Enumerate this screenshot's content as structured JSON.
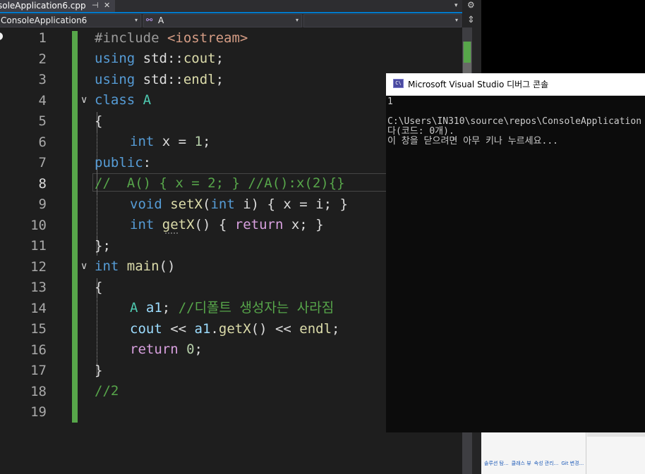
{
  "tab": {
    "title": "soleApplication6.cpp",
    "pin_glyph": "⊣",
    "close_glyph": "✕",
    "dropdown_glyph": "▾",
    "settings_glyph": "⚙"
  },
  "nav": {
    "project": "ConsoleApplication6",
    "class": "A",
    "member": "",
    "caret": "▾",
    "split_glyph": "⇕"
  },
  "editor": {
    "line_numbers": [
      "1",
      "2",
      "3",
      "4",
      "5",
      "6",
      "7",
      "8",
      "9",
      "10",
      "11",
      "12",
      "13",
      "14",
      "15",
      "16",
      "17",
      "18",
      "19"
    ],
    "current_line": 8,
    "fold_glyph": "∨"
  },
  "code": {
    "l1": [
      "#include ",
      "<iostream>"
    ],
    "l2": [
      "using",
      " std::",
      "cout",
      ";"
    ],
    "l3": [
      "using",
      " std::",
      "endl",
      ";"
    ],
    "l4": [
      "class",
      " ",
      "A"
    ],
    "l5": [
      "{"
    ],
    "l6": [
      "int",
      " x = ",
      "1",
      ";"
    ],
    "l7": [
      "public",
      ":"
    ],
    "l8": [
      "//  A() { x = 2; } //A():x(2){}"
    ],
    "l9": [
      "void",
      " ",
      "setX",
      "(",
      "int",
      " i) { x = i; }"
    ],
    "l10": [
      "int",
      " ",
      "getX",
      "() { ",
      "return",
      " x; }"
    ],
    "l11": [
      "};"
    ],
    "l12": [
      "int",
      " ",
      "main",
      "()"
    ],
    "l13": [
      "{"
    ],
    "l14": [
      "A",
      " ",
      "a1",
      "; ",
      "//디폴트 생성자는 사라짐"
    ],
    "l15": [
      "cout",
      " << ",
      "a1",
      ".",
      "getX",
      "() << ",
      "endl",
      ";"
    ],
    "l16": [
      "return",
      " ",
      "0",
      ";"
    ],
    "l17": [
      "}"
    ],
    "l18": [
      "//2"
    ]
  },
  "console": {
    "icon_text": "C\\",
    "title": "Microsoft Visual Studio 디버그 콘솔",
    "output": "1\n\nC:\\Users\\IN310\\source\\repos\\ConsoleApplication\n다(코드: 0개).\n이 창을 닫으려면 아무 키나 누르세요..."
  },
  "bottom_tabs": [
    "솔루션 탐...",
    "클래스 뷰",
    "속성 관리...",
    "Git 변경..."
  ],
  "colors": {
    "keyword": "#569cd6",
    "type": "#4ec9b0",
    "function": "#dcdcaa",
    "string": "#d69d85",
    "number": "#b5cea8",
    "comment": "#57a64a",
    "control": "#d8a0df",
    "accent": "#007acc"
  }
}
